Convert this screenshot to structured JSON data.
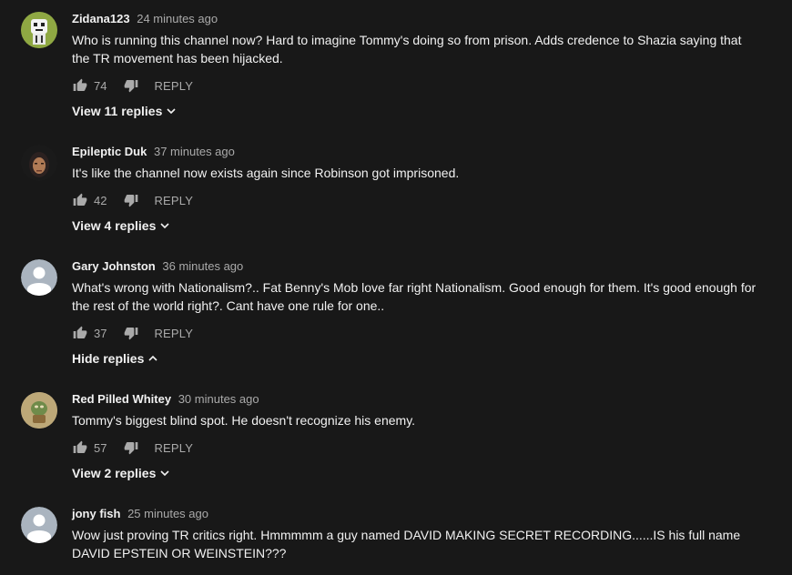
{
  "comments": [
    {
      "author": "Zidana123",
      "time": "24 minutes ago",
      "text_lines": [
        "Who is running this channel now? Hard to imagine Tommy's doing so from prison. Adds credence to Shazia saying that",
        "the TR movement has been hijacked."
      ],
      "likes": "74",
      "reply_label": "REPLY",
      "replies_label": "View 11 replies",
      "replies_icon": "chevron-down-icon"
    },
    {
      "author": "Epileptic Duk",
      "time": "37 minutes ago",
      "text_lines": [
        "It's like the channel now exists again since Robinson got imprisoned."
      ],
      "likes": "42",
      "reply_label": "REPLY",
      "replies_label": "View 4 replies",
      "replies_icon": "chevron-down-icon"
    },
    {
      "author": "Gary Johnston",
      "time": "36 minutes ago",
      "text_lines": [
        "What's wrong with Nationalism?.. Fat Benny's Mob love far right Nationalism. Good enough for them. It's good enough for",
        "the rest of the world right?. Cant have one rule for one.."
      ],
      "likes": "37",
      "reply_label": "REPLY",
      "replies_label": "Hide replies",
      "replies_icon": "chevron-up-icon"
    },
    {
      "author": "Red Pilled Whitey",
      "time": "30 minutes ago",
      "text_lines": [
        "Tommy's biggest blind spot.  He doesn't recognize his enemy."
      ],
      "likes": "57",
      "reply_label": "REPLY",
      "replies_label": "View 2 replies",
      "replies_icon": "chevron-down-icon"
    },
    {
      "author": "jony fish",
      "time": "25 minutes ago",
      "text_lines": [
        "Wow just proving TR critics right. Hmmmmm a guy named DAVID  MAKING SECRET RECORDING......IS his full name",
        "DAVID EPSTEIN OR WEINSTEIN???"
      ]
    }
  ],
  "colors": {
    "background": "#181818",
    "text_primary": "#f1f1f1",
    "text_secondary": "#aaaaaa",
    "default_avatar_bg": "#aab4bf"
  }
}
